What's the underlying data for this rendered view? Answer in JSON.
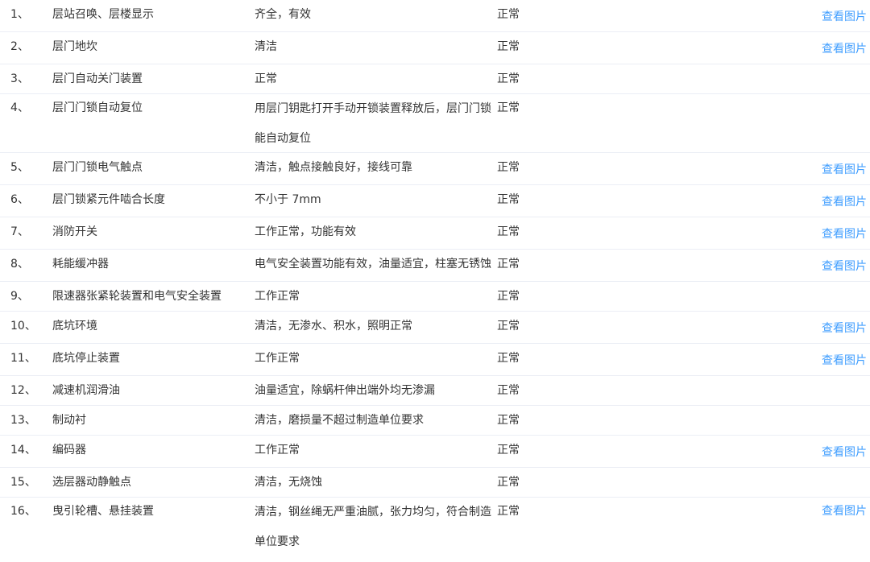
{
  "link_color": "#409eff",
  "rows": [
    {
      "no": "1、",
      "item": "层站召唤、层楼显示",
      "requirement": "齐全，有效",
      "result": "正常",
      "link": "查看图片"
    },
    {
      "no": "2、",
      "item": "层门地坎",
      "requirement": "清洁",
      "result": "正常",
      "link": "查看图片"
    },
    {
      "no": "3、",
      "item": "层门自动关门装置",
      "requirement": "正常",
      "result": "正常",
      "link": ""
    },
    {
      "no": "4、",
      "item": "层门门锁自动复位",
      "requirement": "用层门钥匙打开手动开锁装置释放后，层门门锁能自动复位",
      "result": "正常",
      "link": ""
    },
    {
      "no": "5、",
      "item": "层门门锁电气触点",
      "requirement": "清洁，触点接触良好，接线可靠",
      "result": "正常",
      "link": "查看图片"
    },
    {
      "no": "6、",
      "item": "层门锁紧元件啮合长度",
      "requirement": "不小于 7mm",
      "result": "正常",
      "link": "查看图片"
    },
    {
      "no": "7、",
      "item": "消防开关",
      "requirement": "工作正常，功能有效",
      "result": "正常",
      "link": "查看图片"
    },
    {
      "no": "8、",
      "item": "耗能缓冲器",
      "requirement": "电气安全装置功能有效，油量适宜，柱塞无锈蚀",
      "result": "正常",
      "link": "查看图片"
    },
    {
      "no": "9、",
      "item": "限速器张紧轮装置和电气安全装置",
      "requirement": "工作正常",
      "result": "正常",
      "link": ""
    },
    {
      "no": "10、",
      "item": "底坑环境",
      "requirement": "清洁，无渗水、积水，照明正常",
      "result": "正常",
      "link": "查看图片"
    },
    {
      "no": "11、",
      "item": "底坑停止装置",
      "requirement": "工作正常",
      "result": "正常",
      "link": "查看图片"
    },
    {
      "no": "12、",
      "item": "减速机润滑油",
      "requirement": "油量适宜，除蜗杆伸出端外均无渗漏",
      "result": "正常",
      "link": ""
    },
    {
      "no": "13、",
      "item": "制动衬",
      "requirement": "清洁，磨损量不超过制造单位要求",
      "result": "正常",
      "link": ""
    },
    {
      "no": "14、",
      "item": "编码器",
      "requirement": "工作正常",
      "result": "正常",
      "link": "查看图片"
    },
    {
      "no": "15、",
      "item": "选层器动静触点",
      "requirement": "清洁，无烧蚀",
      "result": "正常",
      "link": ""
    },
    {
      "no": "16、",
      "item": "曳引轮槽、悬挂装置",
      "requirement": "清洁，钢丝绳无严重油腻，张力均匀，符合制造单位要求",
      "result": "正常",
      "link": "查看图片"
    }
  ]
}
